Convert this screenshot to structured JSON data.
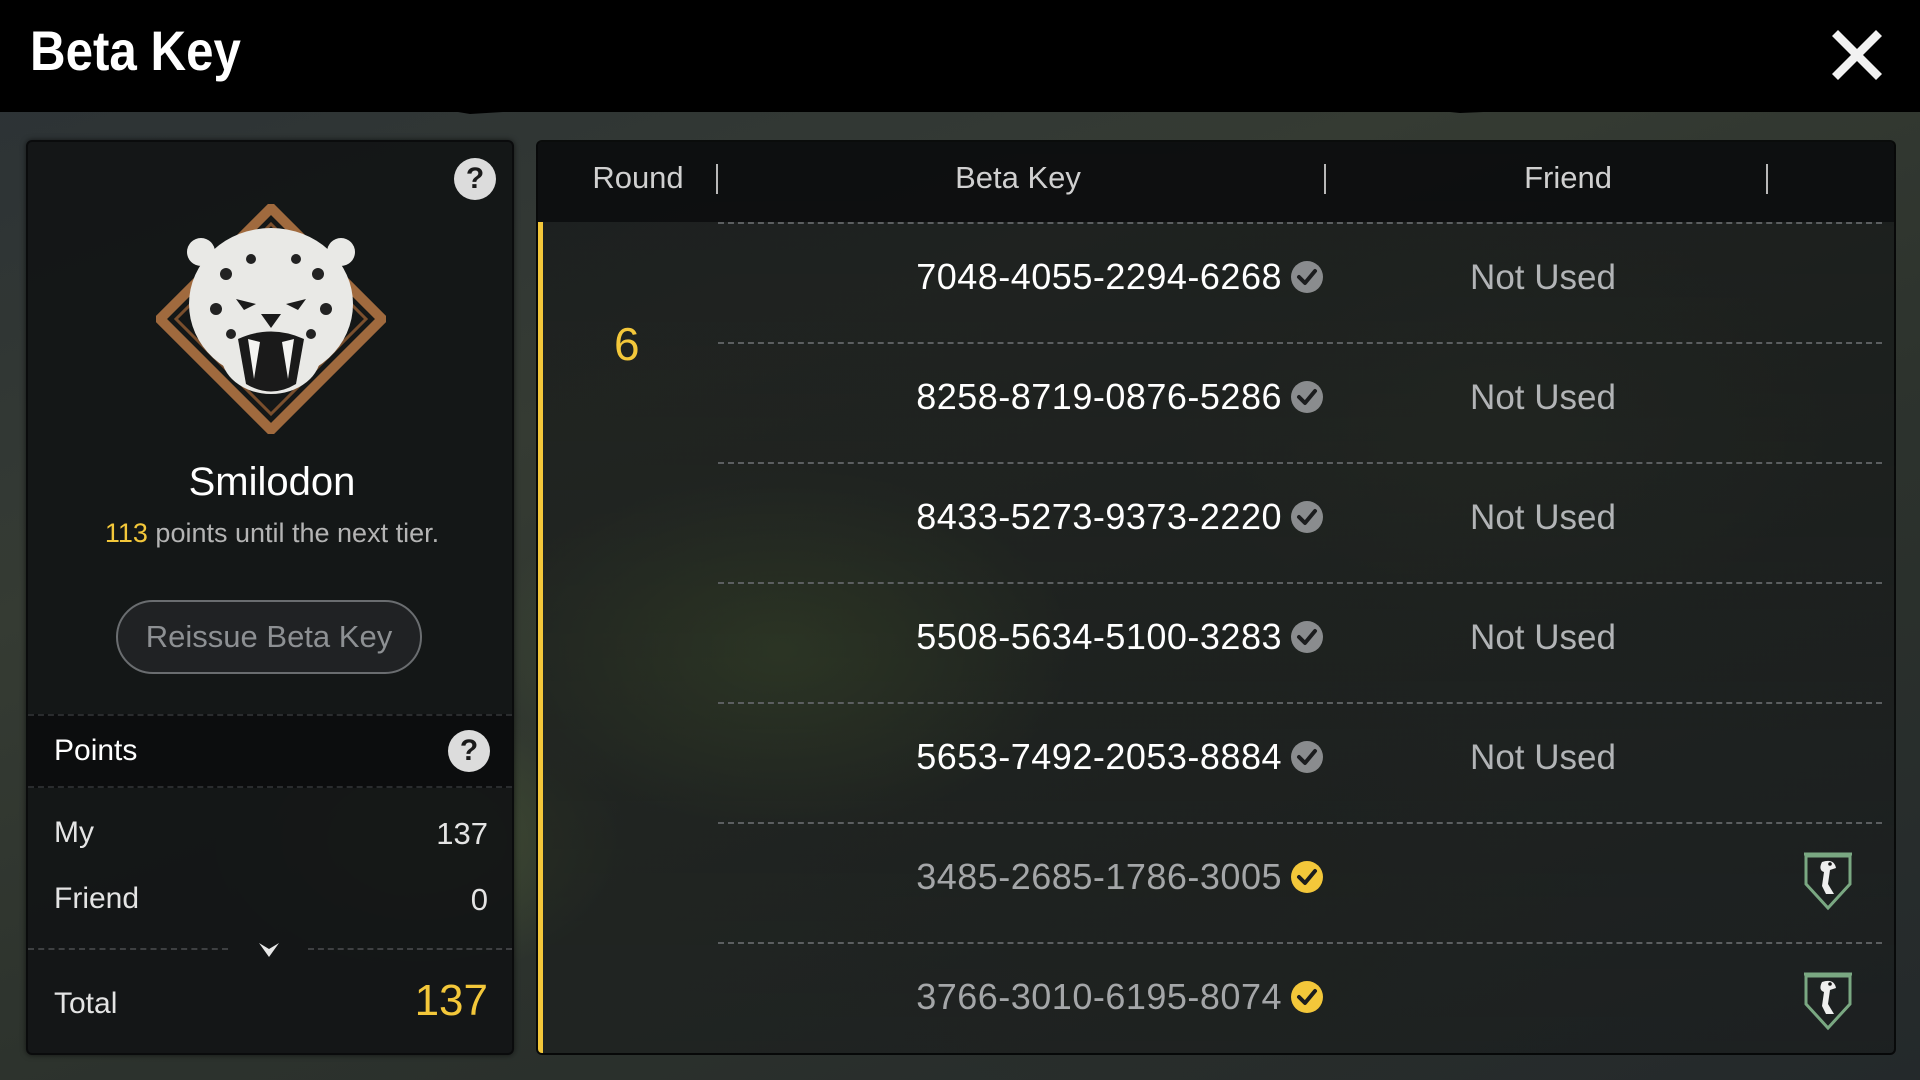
{
  "header": {
    "title": "Beta Key",
    "close_icon": "close-icon"
  },
  "tier": {
    "name": "Smilodon",
    "emblem_icon": "smilodon-emblem-icon",
    "points_to_next": "113",
    "points_to_next_suffix": " points until the next tier."
  },
  "reissue_button": {
    "label": "Reissue Beta Key"
  },
  "points": {
    "title": "Points",
    "my_label": "My",
    "my_value": "137",
    "friend_label": "Friend",
    "friend_value": "0",
    "total_label": "Total",
    "total_value": "137"
  },
  "table": {
    "columns": {
      "round": "Round",
      "beta_key": "Beta Key",
      "friend": "Friend"
    },
    "round": "6",
    "rows": [
      {
        "key": "7048-4055-2294-6268",
        "friend": "Not Used",
        "used": false
      },
      {
        "key": "8258-8719-0876-5286",
        "friend": "Not Used",
        "used": false
      },
      {
        "key": "8433-5273-9373-2220",
        "friend": "Not Used",
        "used": false
      },
      {
        "key": "5508-5634-5100-3283",
        "friend": "Not Used",
        "used": false
      },
      {
        "key": "5653-7492-2053-8884",
        "friend": "Not Used",
        "used": false
      },
      {
        "key": "3485-2685-1786-3005",
        "friend": "",
        "used": true,
        "friend_icon": "raptor-badge-icon"
      },
      {
        "key": "3766-3010-6195-8074",
        "friend": "",
        "used": true,
        "friend_icon": "raptor-badge-icon"
      }
    ]
  },
  "colors": {
    "accent": "#f3c73a",
    "verified_gray": "#8a8c8e",
    "badge_green": "#7aa882"
  }
}
